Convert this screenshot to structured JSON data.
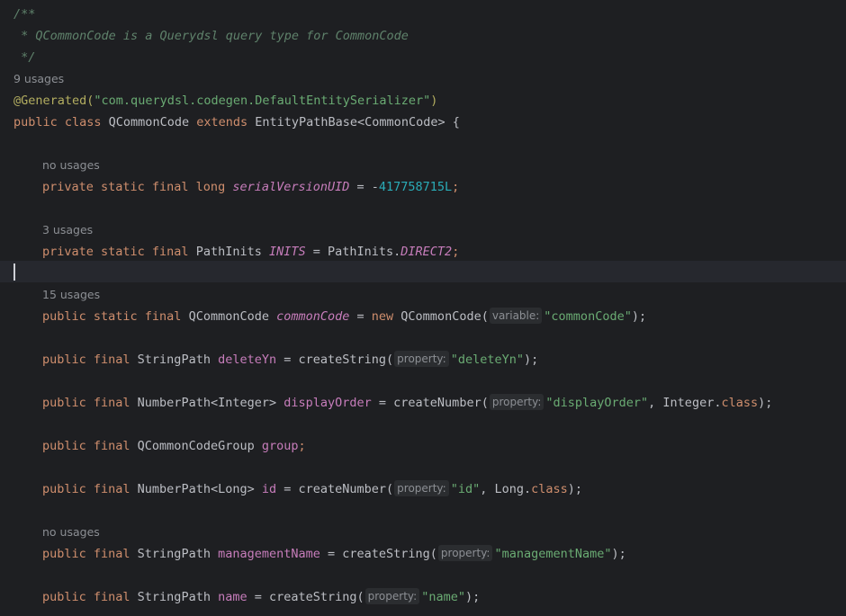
{
  "editor": {
    "javadoc": [
      "/**",
      " * QCommonCode is a Querydsl query type for CommonCode",
      " */"
    ],
    "usages": {
      "class": "9 usages",
      "serial": "no usages",
      "inits": "3 usages",
      "common_code": "15 usages",
      "management_name": "no usages"
    },
    "annotation_name": "@Generated",
    "annotation_value": "\"com.querydsl.codegen.DefaultEntitySerializer\"",
    "class_decl": {
      "modifiers": "public class ",
      "name": "QCommonCode ",
      "extends": "extends ",
      "super": "EntityPathBase",
      "generic": "<CommonCode>",
      "brace": " {"
    },
    "lines": {
      "serial": {
        "mods": "private static final long ",
        "name": "serialVersionUID",
        "eq": " = -",
        "value": "417758715L",
        "end": ";"
      },
      "inits": {
        "mods": "private static final ",
        "type": "PathInits ",
        "name": "INITS",
        "eq": " = PathInits.",
        "value": "DIRECT2",
        "end": ";"
      },
      "common_code": {
        "mods": "public static final ",
        "type": "QCommonCode ",
        "name": "commonCode",
        "eq": " = ",
        "new": "new ",
        "call": "QCommonCode(",
        "hint": "variable:",
        "arg": "\"commonCode\"",
        "end": ");"
      },
      "delete_yn": {
        "mods": "public final ",
        "type": "StringPath ",
        "name": "deleteYn",
        "eq": " = createString(",
        "hint": "property:",
        "arg": "\"deleteYn\"",
        "end": ");"
      },
      "display_order": {
        "mods": "public final ",
        "type": "NumberPath<Integer> ",
        "name": "displayOrder",
        "eq": " = createNumber(",
        "hint": "property:",
        "arg": "\"displayOrder\"",
        "sep": ", Integer.",
        "class_kw": "class",
        "end": ");"
      },
      "group": {
        "mods": "public final ",
        "type": "QCommonCodeGroup ",
        "name": "group",
        "end": ";"
      },
      "id": {
        "mods": "public final ",
        "type": "NumberPath<Long> ",
        "name": "id",
        "eq": " = createNumber(",
        "hint": "property:",
        "arg": "\"id\"",
        "sep": ", Long.",
        "class_kw": "class",
        "end": ");"
      },
      "management_name": {
        "mods": "public final ",
        "type": "StringPath ",
        "name": "managementName",
        "eq": " = createString(",
        "hint": "property:",
        "arg": "\"managementName\"",
        "end": ");"
      },
      "name": {
        "mods": "public final ",
        "type": "StringPath ",
        "name": "name",
        "eq": " = createString(",
        "hint": "property:",
        "arg": "\"name\"",
        "end": ");"
      }
    }
  }
}
